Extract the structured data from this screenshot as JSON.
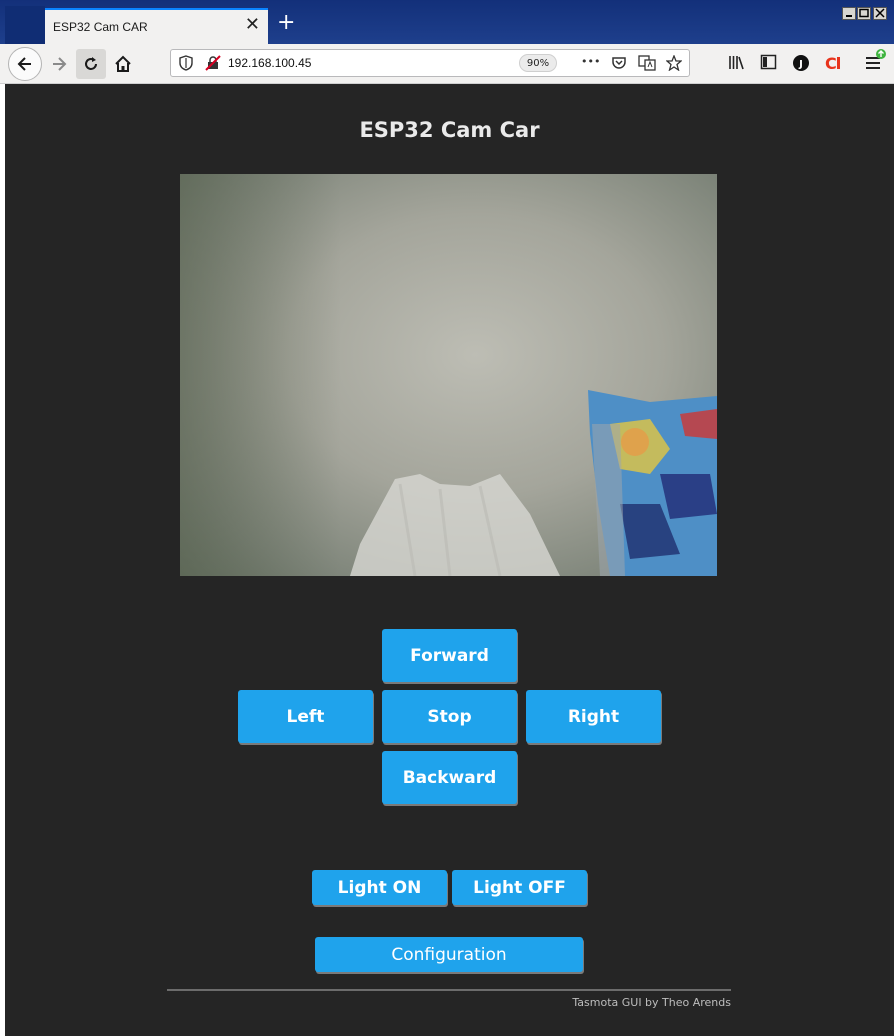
{
  "browser": {
    "tab_title": "ESP32 Cam CAR",
    "tab_close": "✕",
    "new_tab": "+",
    "url": "192.168.100.45",
    "zoom": "90%",
    "url_more": "•••"
  },
  "page": {
    "title": "ESP32 Cam Car",
    "controls": {
      "forward": "Forward",
      "left": "Left",
      "stop": "Stop",
      "right": "Right",
      "backward": "Backward"
    },
    "light_on": "Light ON",
    "light_off": "Light OFF",
    "configuration": "Configuration",
    "footer": "Tasmota GUI by Theo Arends"
  },
  "colors": {
    "page_bg": "#252525",
    "button": "#1fa3ec",
    "title_text": "#eaeaea"
  }
}
